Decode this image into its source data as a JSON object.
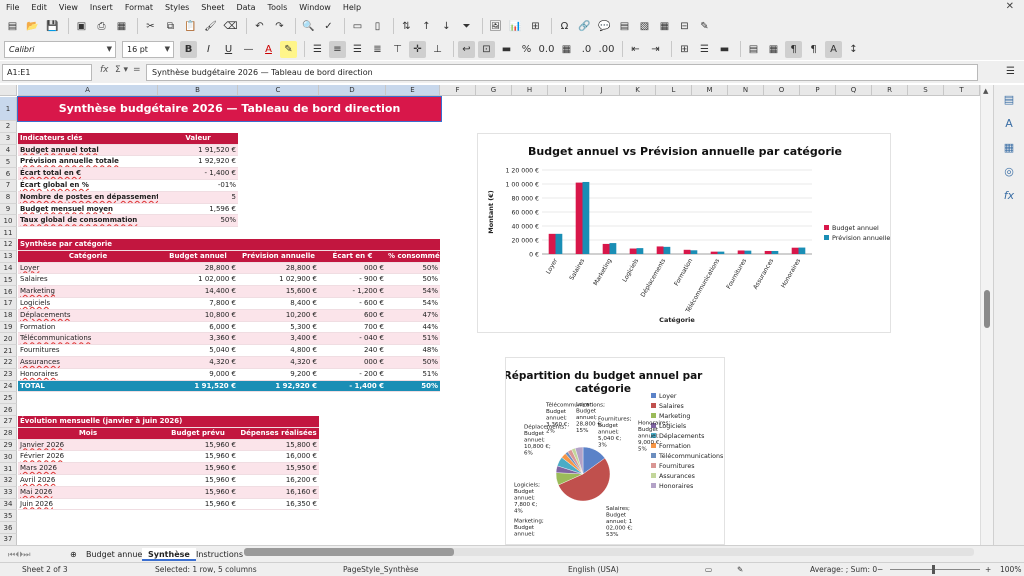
{
  "menu": [
    "File",
    "Edit",
    "View",
    "Insert",
    "Format",
    "Styles",
    "Sheet",
    "Data",
    "Tools",
    "Window",
    "Help"
  ],
  "font": {
    "name": "Calibri",
    "size": "16 pt"
  },
  "name_box": "A1:E1",
  "formula": "Synthèse budgétaire 2026 — Tableau de bord direction",
  "columns": [
    "A",
    "B",
    "C",
    "D",
    "E",
    "F",
    "G",
    "H",
    "I",
    "J",
    "K",
    "L",
    "M",
    "N",
    "O",
    "P",
    "Q",
    "R",
    "S",
    "T"
  ],
  "rows": [
    "1",
    "2",
    "3",
    "4",
    "5",
    "6",
    "7",
    "8",
    "9",
    "10",
    "11",
    "12",
    "13",
    "14",
    "15",
    "16",
    "17",
    "18",
    "19",
    "20",
    "21",
    "22",
    "23",
    "24",
    "25",
    "26",
    "27",
    "28",
    "29",
    "30",
    "31",
    "32",
    "33",
    "34",
    "35",
    "36",
    "37"
  ],
  "title": "Synthèse budgétaire 2026 — Tableau de bord direction",
  "indicators": {
    "header": [
      "Indicateurs clés",
      "Valeur"
    ],
    "rows": [
      [
        "Budget annuel total",
        "1 91,520 €"
      ],
      [
        "Prévision annuelle totale",
        "1 92,920 €"
      ],
      [
        "Écart total en €",
        "- 1,400 €"
      ],
      [
        "Écart global en %",
        "-01%"
      ],
      [
        "Nombre de postes en dépassement",
        "5"
      ],
      [
        "Budget mensuel moyen",
        "1,596 €"
      ],
      [
        "Taux global de consommation",
        "50%"
      ]
    ]
  },
  "category": {
    "section": "Synthèse par catégorie",
    "header": [
      "Catégorie",
      "Budget annuel",
      "Prévision annuelle",
      "Écart en €",
      "% consommé"
    ],
    "rows": [
      [
        "Loyer",
        "28,800 €",
        "28,800 €",
        "000 €",
        "50%"
      ],
      [
        "Salaires",
        "1 02,000 €",
        "1 02,900 €",
        "- 900 €",
        "50%"
      ],
      [
        "Marketing",
        "14,400 €",
        "15,600 €",
        "- 1,200 €",
        "54%"
      ],
      [
        "Logiciels",
        "7,800 €",
        "8,400 €",
        "- 600 €",
        "54%"
      ],
      [
        "Déplacements",
        "10,800 €",
        "10,200 €",
        "600 €",
        "47%"
      ],
      [
        "Formation",
        "6,000 €",
        "5,300 €",
        "700 €",
        "44%"
      ],
      [
        "Télécommunications",
        "3,360 €",
        "3,400 €",
        "- 040 €",
        "51%"
      ],
      [
        "Fournitures",
        "5,040 €",
        "4,800 €",
        "240 €",
        "48%"
      ],
      [
        "Assurances",
        "4,320 €",
        "4,320 €",
        "000 €",
        "50%"
      ],
      [
        "Honoraires",
        "9,000 €",
        "9,200 €",
        "- 200 €",
        "51%"
      ]
    ],
    "total": [
      "TOTAL",
      "1 91,520 €",
      "1 92,920 €",
      "- 1,400 €",
      "50%"
    ]
  },
  "monthly": {
    "section": "Évolution mensuelle (janvier à juin 2026)",
    "header": [
      "Mois",
      "Budget prévu",
      "Dépenses réalisées"
    ],
    "rows": [
      [
        "Janvier 2026",
        "15,960 €",
        "15,800 €"
      ],
      [
        "Février 2026",
        "15,960 €",
        "16,000 €"
      ],
      [
        "Mars 2026",
        "15,960 €",
        "15,950 €"
      ],
      [
        "Avril 2026",
        "15,960 €",
        "16,200 €"
      ],
      [
        "Mai 2026",
        "15,960 €",
        "16,160 €"
      ],
      [
        "Juin 2026",
        "15,960 €",
        "16,350 €"
      ]
    ]
  },
  "chart_data": [
    {
      "type": "bar",
      "title": "Budget annuel vs Prévision annuelle par catégorie",
      "xlabel": "Catégorie",
      "ylabel": "Montant (€)",
      "ylim": [
        0,
        120000
      ],
      "yticks": [
        "0 €",
        "20 000 €",
        "40 000 €",
        "60 000 €",
        "80 000 €",
        "1 00 000 €",
        "1 20 000 €"
      ],
      "categories": [
        "Loyer",
        "Salaires",
        "Marketing",
        "Logiciels",
        "Déplacements",
        "Formation",
        "Télécommunications",
        "Fournitures",
        "Assurances",
        "Honoraires"
      ],
      "series": [
        {
          "name": "Budget annuel",
          "color": "#d8174a",
          "values": [
            28800,
            102000,
            14400,
            7800,
            10800,
            6000,
            3360,
            5040,
            4320,
            9000
          ]
        },
        {
          "name": "Prévision annuelle",
          "color": "#1a8eb5",
          "values": [
            28800,
            102900,
            15600,
            8400,
            10200,
            5300,
            3400,
            4800,
            4320,
            9200
          ]
        }
      ],
      "legend": "right"
    },
    {
      "type": "pie",
      "title": "Répartition du budget annuel par catégorie",
      "categories": [
        "Loyer",
        "Salaires",
        "Marketing",
        "Logiciels",
        "Déplacements",
        "Formation",
        "Télécommunications",
        "Fournitures",
        "Assurances",
        "Honoraires"
      ],
      "values": [
        28800,
        102000,
        14400,
        7800,
        10800,
        6000,
        3360,
        5040,
        4320,
        9000
      ],
      "colors": [
        "#5b82c8",
        "#c0504d",
        "#9bbb59",
        "#8064a2",
        "#4bacc6",
        "#f79646",
        "#6c8ebf",
        "#d99694",
        "#c3d69b",
        "#b3a2c7"
      ],
      "legend": "right",
      "labels": [
        {
          "text": "Salaires; Budget annuel; 1 02,000 €; 53%"
        },
        {
          "text": "Déplacements; Budget annuel; 10,800 €; 6%"
        },
        {
          "text": "Logiciels; Budget annuel; 7,800 €; 4%"
        },
        {
          "text": "Marketing; Budget annuel;"
        },
        {
          "text": "Honoraires; Budget annuel; 9,000 €; 5%"
        },
        {
          "text": "Fournitures; Budget annuel; 5,040 €; 3%"
        },
        {
          "text": "Loyer; Budget annuel; 28,800 €; 15%"
        },
        {
          "text": "Télécommunications; Budget annuel; 3,360 €; 2%"
        }
      ]
    }
  ],
  "tabs": [
    "Budget annuel",
    "Synthèse",
    "Instructions"
  ],
  "active_tab": "Synthèse",
  "status": {
    "sheet": "Sheet 2 of 3",
    "selection": "Selected: 1 row, 5 columns",
    "pagestyle": "PageStyle_Synthèse",
    "language": "English (USA)",
    "summary": "Average: ; Sum: 0",
    "zoom": "100%"
  }
}
